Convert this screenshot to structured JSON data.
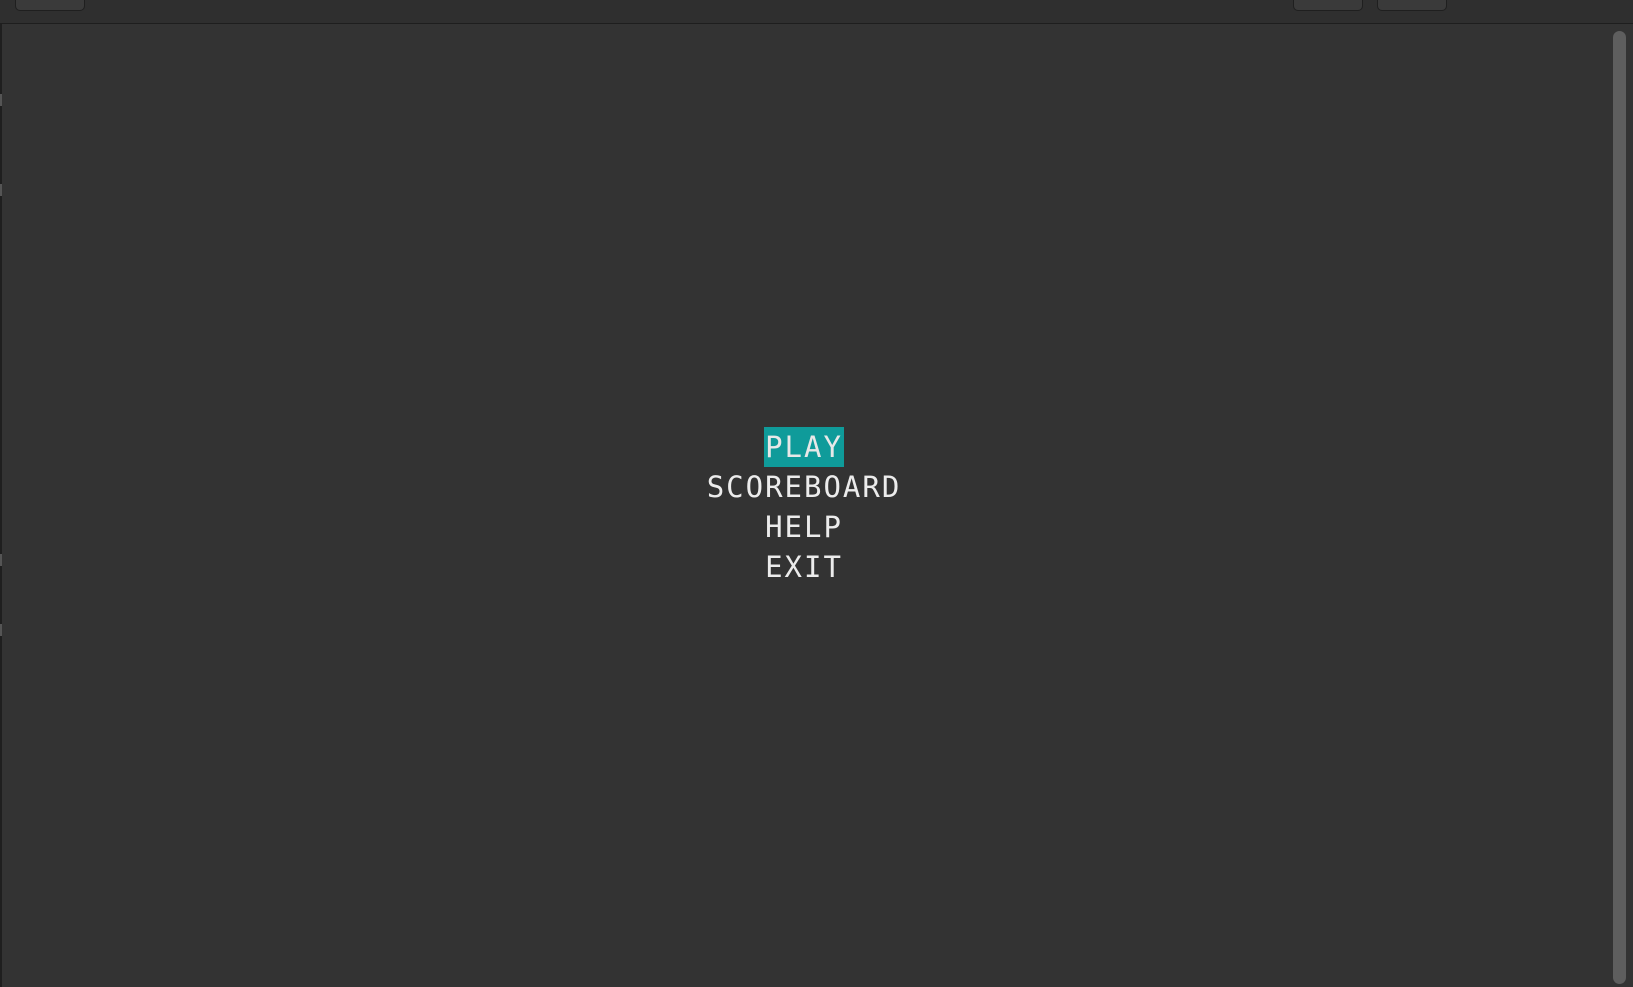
{
  "menu": {
    "items": [
      {
        "label": "PLAY",
        "selected": true
      },
      {
        "label": "SCOREBOARD",
        "selected": false
      },
      {
        "label": "HELP",
        "selected": false
      },
      {
        "label": "EXIT",
        "selected": false
      }
    ]
  },
  "colors": {
    "background": "#333333",
    "selection": "#0f9b9a",
    "text": "#ececec"
  }
}
